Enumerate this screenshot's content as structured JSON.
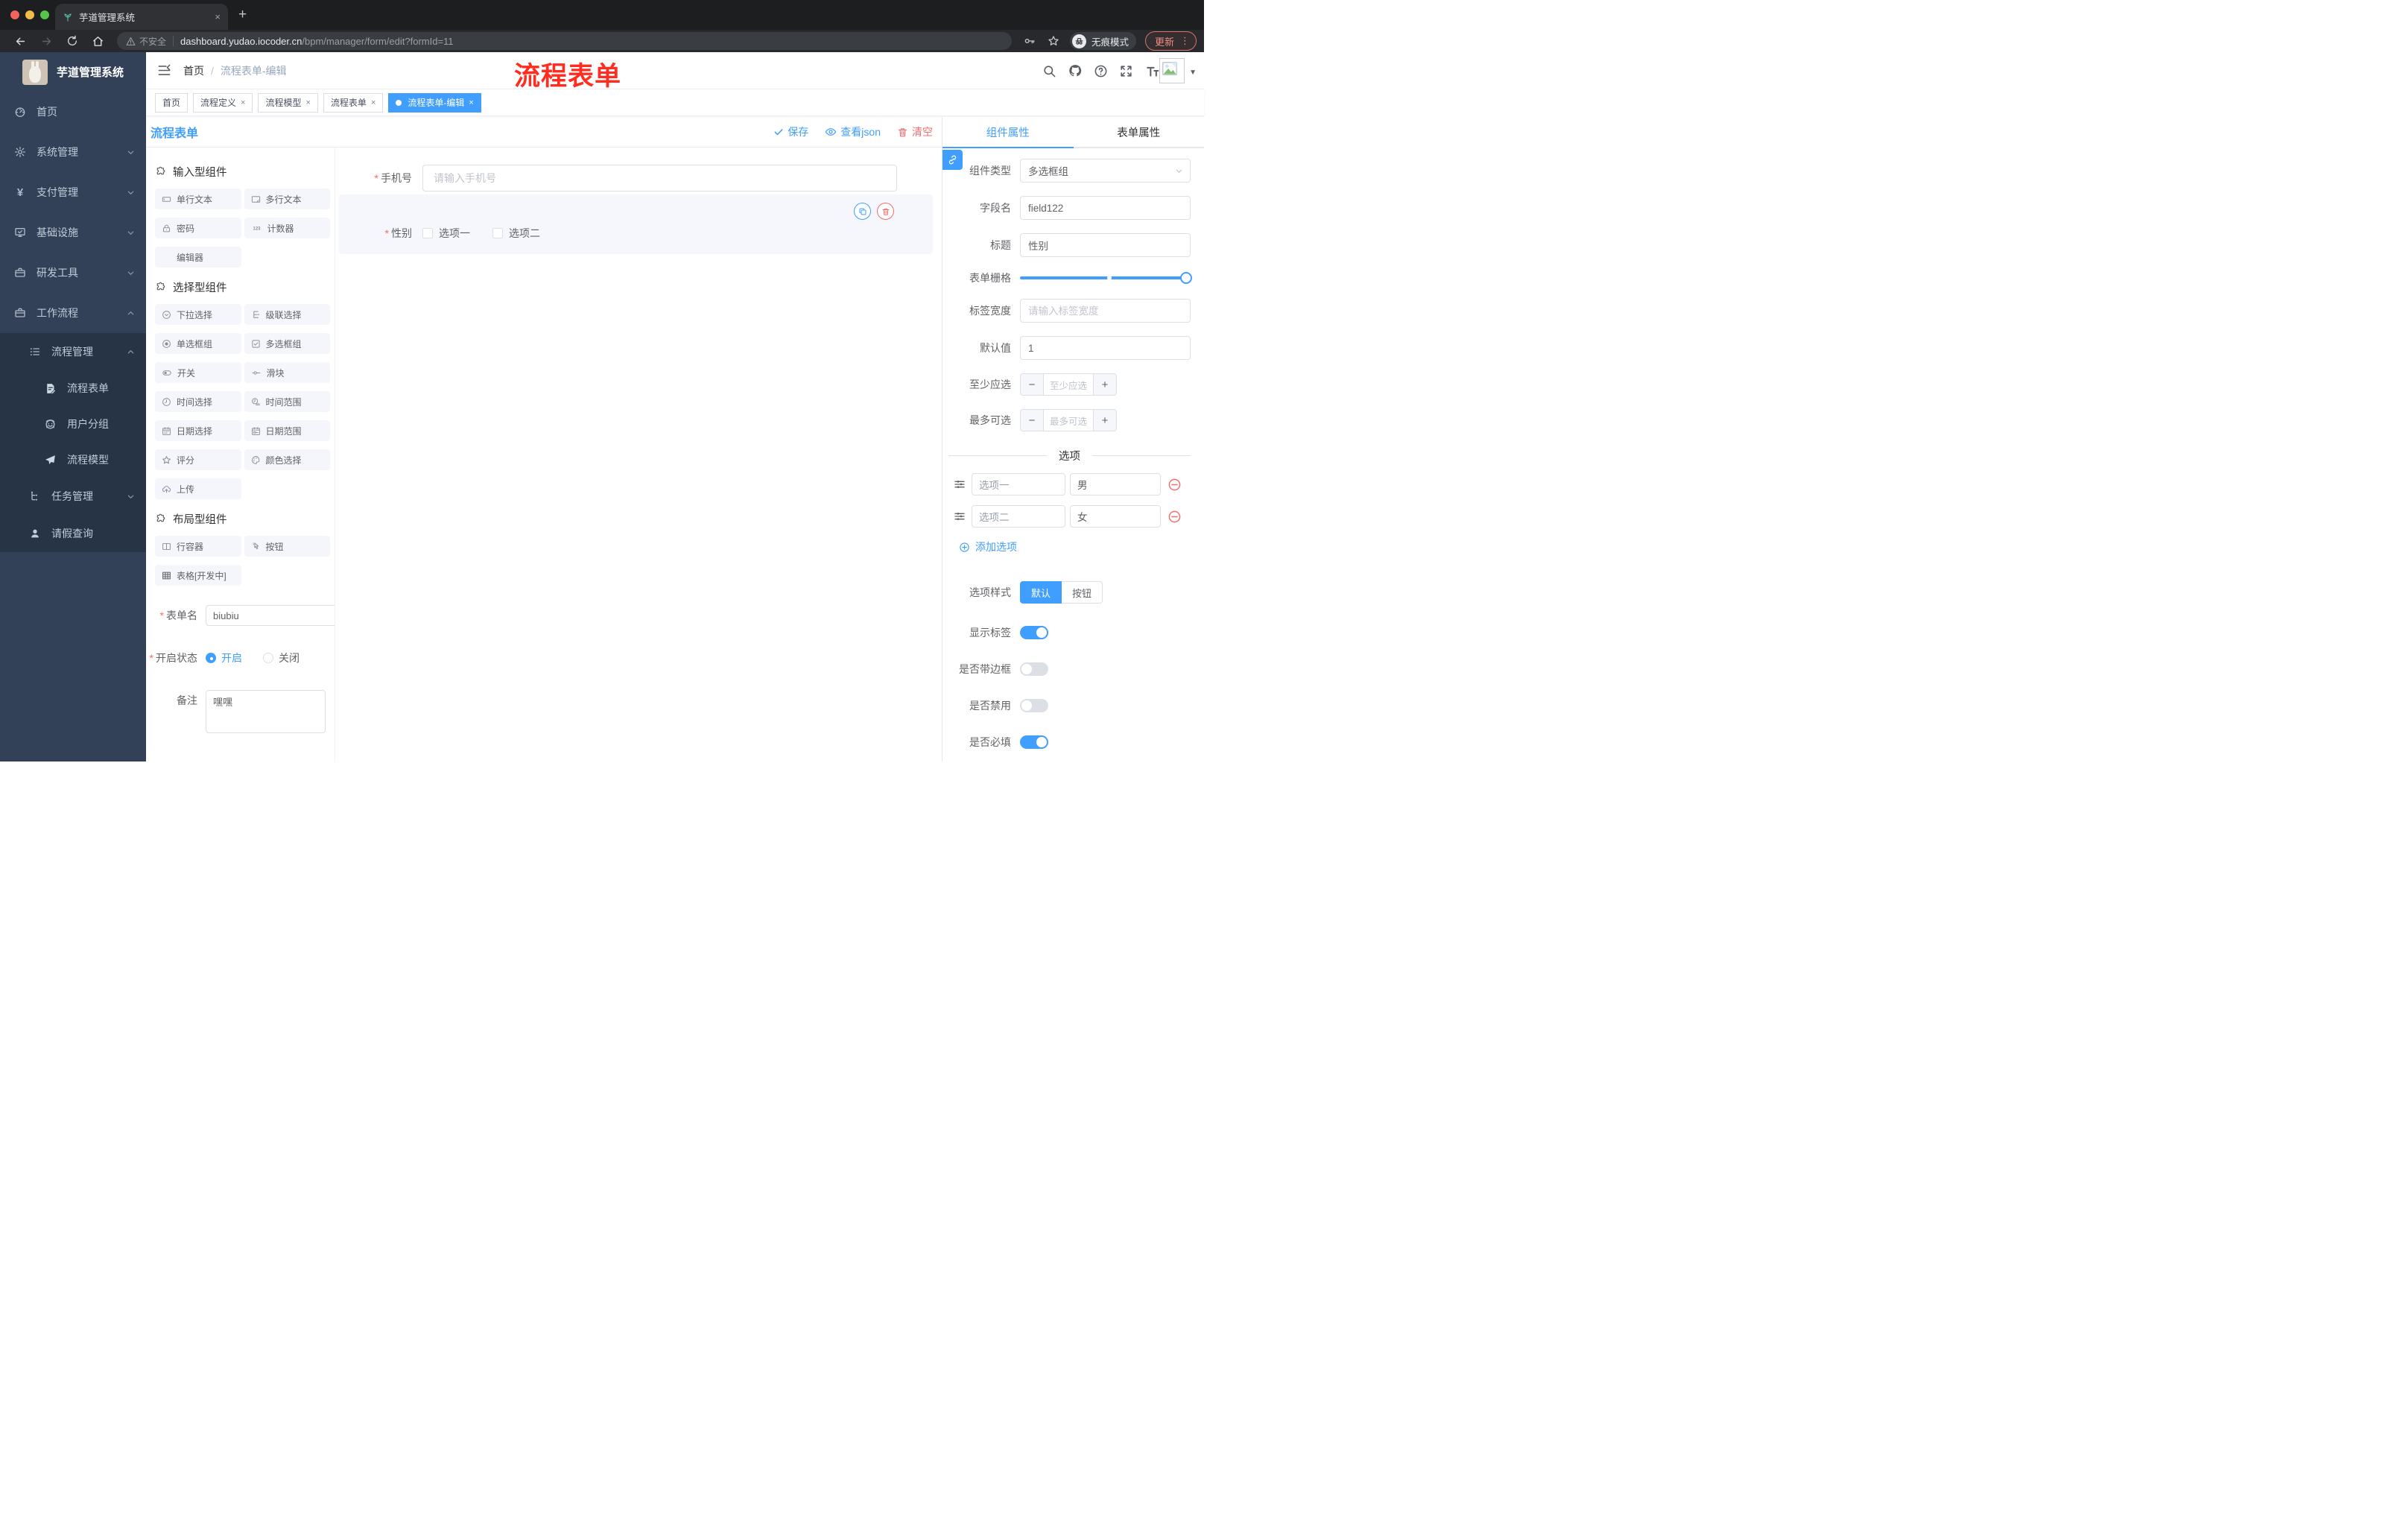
{
  "theme": {
    "accent": "#409eff",
    "danger": "#f56c6c",
    "sidebar_bg": "#324157",
    "sidebar_sub_bg": "#263445"
  },
  "browser": {
    "tab_title": "芋道管理系统",
    "close_tab": "×",
    "security_label": "不安全",
    "url_host": "dashboard.yudao.iocoder.cn",
    "url_path": "/bpm/manager/form/edit?formId=11",
    "incognito_label": "无痕模式",
    "update_label": "更新"
  },
  "sidebar": {
    "logo_title": "芋道管理系统",
    "items": [
      {
        "label": "首页"
      },
      {
        "label": "系统管理"
      },
      {
        "label": "支付管理"
      },
      {
        "label": "基础设施"
      },
      {
        "label": "研发工具"
      },
      {
        "label": "工作流程"
      },
      {
        "label": "流程管理"
      },
      {
        "label": "流程表单"
      },
      {
        "label": "用户分组"
      },
      {
        "label": "流程模型"
      },
      {
        "label": "任务管理"
      },
      {
        "label": "请假查询"
      }
    ]
  },
  "header": {
    "breadcrumb_home": "首页",
    "breadcrumb_sep": "/",
    "breadcrumb_current": "流程表单-编辑",
    "annotation": "流程表单"
  },
  "tags": [
    {
      "label": "首页"
    },
    {
      "label": "流程定义",
      "close": "×"
    },
    {
      "label": "流程模型",
      "close": "×"
    },
    {
      "label": "流程表单",
      "close": "×"
    },
    {
      "label": "流程表单-编辑",
      "close": "×"
    }
  ],
  "designer": {
    "title": "流程表单",
    "save_label": "保存",
    "view_json_label": "查看json",
    "clear_label": "清空"
  },
  "palette": {
    "sections": [
      {
        "title": "输入型组件",
        "items": [
          {
            "label": "单行文本"
          },
          {
            "label": "多行文本"
          },
          {
            "label": "密码"
          },
          {
            "label": "计数器"
          },
          {
            "label": "编辑器"
          }
        ]
      },
      {
        "title": "选择型组件",
        "items": [
          {
            "label": "下拉选择"
          },
          {
            "label": "级联选择"
          },
          {
            "label": "单选框组"
          },
          {
            "label": "多选框组"
          },
          {
            "label": "开关"
          },
          {
            "label": "滑块"
          },
          {
            "label": "时间选择"
          },
          {
            "label": "时间范围"
          },
          {
            "label": "日期选择"
          },
          {
            "label": "日期范围"
          },
          {
            "label": "评分"
          },
          {
            "label": "颜色选择"
          },
          {
            "label": "上传"
          }
        ]
      },
      {
        "title": "布局型组件",
        "items": [
          {
            "label": "行容器"
          },
          {
            "label": "按钮"
          },
          {
            "label": "表格[开发中]"
          }
        ]
      }
    ]
  },
  "form_meta": {
    "name_label": "表单名",
    "name_value": "biubiu",
    "status_label": "开启状态",
    "status_on": "开启",
    "status_off": "关闭",
    "remark_label": "备注",
    "remark_value": "嘿嘿"
  },
  "canvas": {
    "phone_label": "手机号",
    "phone_placeholder": "请输入手机号",
    "gender_label": "性别",
    "gender_option1": "选项一",
    "gender_option2": "选项二"
  },
  "panel": {
    "tab_component": "组件属性",
    "tab_form": "表单属性",
    "type_label": "组件类型",
    "type_value": "多选框组",
    "field_label": "字段名",
    "field_value": "field122",
    "title_label": "标题",
    "title_value": "性别",
    "grid_label": "表单栅格",
    "labelwidth_label": "标签宽度",
    "labelwidth_placeholder": "请输入标签宽度",
    "default_label": "默认值",
    "default_value": "1",
    "min_label": "至少应选",
    "min_placeholder": "至少应选",
    "max_label": "最多可选",
    "max_placeholder": "最多可选",
    "options_title": "选项",
    "options": [
      {
        "label": "选项一",
        "value": "男"
      },
      {
        "label": "选项二",
        "value": "女"
      }
    ],
    "add_option_label": "添加选项",
    "style_label": "选项样式",
    "style_default": "默认",
    "style_button": "按钮",
    "toggles": [
      {
        "label": "显示标签",
        "on": true
      },
      {
        "label": "是否带边框",
        "on": false
      },
      {
        "label": "是否禁用",
        "on": false
      },
      {
        "label": "是否必填",
        "on": true
      }
    ]
  }
}
